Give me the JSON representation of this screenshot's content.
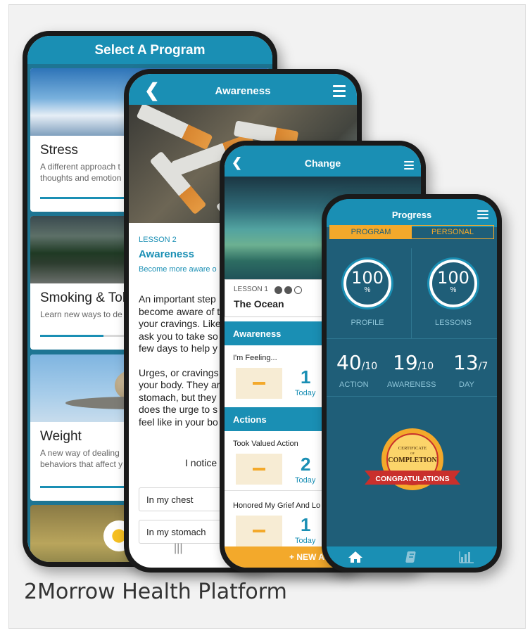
{
  "caption": "2Morrow Health Platform",
  "colors": {
    "brand_teal": "#1a8fb4",
    "accent_orange": "#f3a92b",
    "dark_teal": "#1f5e78"
  },
  "phone1": {
    "title": "Select A Program",
    "programs": [
      {
        "title": "Stress",
        "desc_line1": "A different approach t",
        "desc_line2": "thoughts and emotion",
        "progress": 0.45
      },
      {
        "title": "Smoking & Tob",
        "desc_line1": "Learn new ways to de",
        "desc_line2": "",
        "progress": 0.29
      },
      {
        "title": "Weight",
        "desc_line1": "A new way of dealing",
        "desc_line2": "behaviors that affect y",
        "progress": 0.5
      }
    ]
  },
  "phone2": {
    "title": "Awareness",
    "lesson_label": "LESSON 2",
    "lesson_title": "Awareness",
    "lesson_subtitle": "Become more aware o",
    "body_lines": [
      "An important step",
      "become aware of t",
      "your cravings. Like",
      "ask you to take so",
      "few days to help y",
      "",
      "Urges, or cravings",
      "your body. They ar",
      "stomach, but they",
      "does the urge to s",
      "feel like in your bo"
    ],
    "notice": "I notice",
    "options": [
      "In my chest",
      "In my stomach"
    ],
    "nav_icon": "|||"
  },
  "phone3": {
    "title": "Change",
    "lesson_label": "LESSON 1",
    "lesson_title": "The Ocean",
    "sections": [
      {
        "header": "Awareness",
        "items": [
          {
            "label": "I'm Feeling...",
            "value": "1",
            "unit": "Today"
          }
        ]
      },
      {
        "header": "Actions",
        "items": [
          {
            "label": "Took Valued Action",
            "value": "2",
            "unit": "Today"
          },
          {
            "label": "Honored My Grief And Lo",
            "value": "1",
            "unit": "Today"
          }
        ]
      }
    ],
    "new_button": "+ NEW A"
  },
  "phone4": {
    "title": "Progress",
    "tabs": [
      "PROGRAM",
      "PERSONAL"
    ],
    "rings": [
      {
        "value": "100",
        "unit": "%",
        "label": "PROFILE"
      },
      {
        "value": "100",
        "unit": "%",
        "label": "LESSONS"
      }
    ],
    "stats": [
      {
        "value": "40",
        "denom": "/10",
        "label": "ACTION"
      },
      {
        "value": "19",
        "denom": "/10",
        "label": "AWARENESS"
      },
      {
        "value": "13",
        "denom": "/7",
        "label": "DAY"
      }
    ],
    "badge": {
      "line1": "CERTIFICATE",
      "line2": "OF",
      "line3": "COMPLETION",
      "ribbon": "CONGRATULATIONS"
    }
  }
}
